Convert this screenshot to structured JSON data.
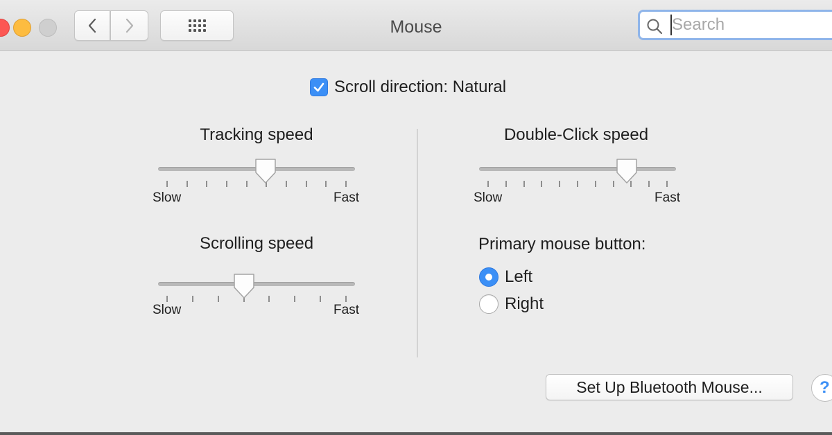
{
  "window": {
    "title": "Mouse"
  },
  "toolbar": {
    "back_icon": "chevron-left-icon",
    "forward_icon": "chevron-right-icon",
    "show_all_icon": "grid-icon"
  },
  "search": {
    "placeholder": "Search",
    "value": ""
  },
  "scroll_direction": {
    "label": "Scroll direction: Natural",
    "checked": true
  },
  "tracking_speed": {
    "title": "Tracking speed",
    "min_label": "Slow",
    "max_label": "Fast",
    "value": 0.55,
    "ticks": 10
  },
  "scrolling_speed": {
    "title": "Scrolling speed",
    "min_label": "Slow",
    "max_label": "Fast",
    "value": 0.43,
    "ticks": 8
  },
  "double_click_speed": {
    "title": "Double-Click speed",
    "min_label": "Slow",
    "max_label": "Fast",
    "value": 0.775,
    "ticks": 11
  },
  "primary_button": {
    "title": "Primary mouse button:",
    "options": [
      {
        "label": "Left",
        "selected": true
      },
      {
        "label": "Right",
        "selected": false
      }
    ]
  },
  "bluetooth_button": {
    "label": "Set Up Bluetooth Mouse..."
  },
  "help_button": {
    "label": "?"
  },
  "colors": {
    "accent": "#3b8ff6",
    "close": "#fc5753",
    "minimize": "#fdbc40",
    "zoom": "#cfcfcf"
  }
}
